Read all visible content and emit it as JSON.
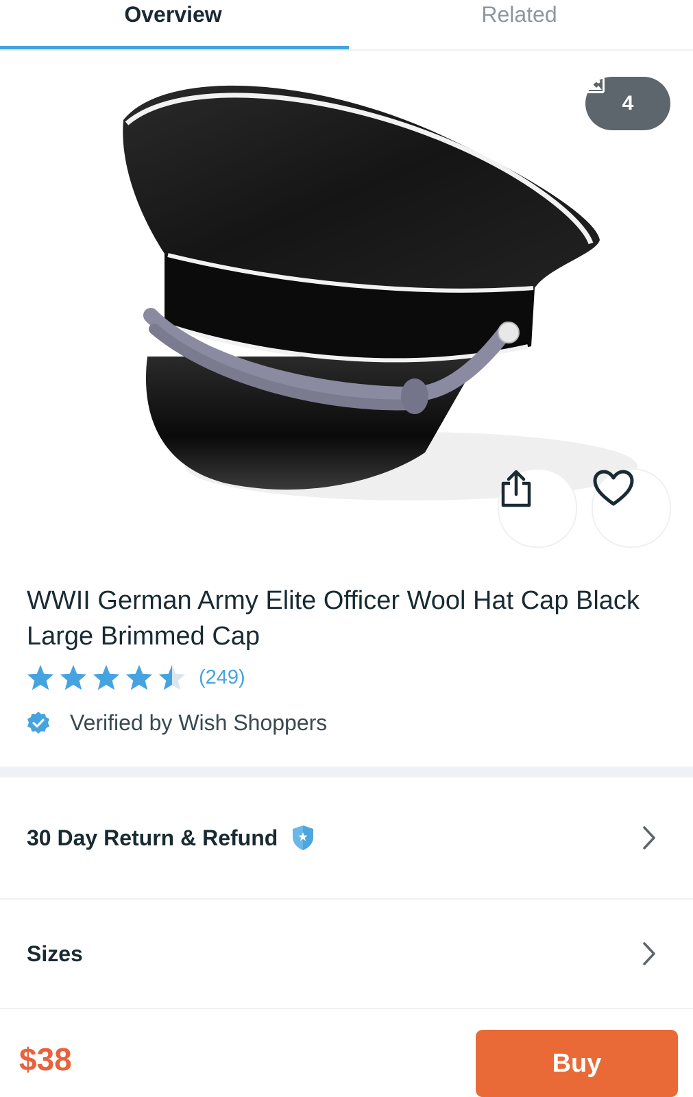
{
  "tabs": [
    {
      "label": "Overview",
      "active": true
    },
    {
      "label": "Related",
      "active": false
    }
  ],
  "gallery": {
    "photo_count": "4",
    "photo_icon": "image-icon",
    "share_icon": "share-icon",
    "wishlist_icon": "heart-icon"
  },
  "product": {
    "title": "WWII German Army Elite Officer Wool Hat Cap Black Large Brimmed Cap",
    "rating_stars": 4.5,
    "rating_count": "(249)",
    "verified_text": "Verified by Wish Shoppers"
  },
  "rows": {
    "return_label": "30 Day Return & Refund",
    "sizes_label": "Sizes"
  },
  "footer": {
    "price": "$38",
    "buy_label": "Buy"
  },
  "colors": {
    "accent_blue": "#45a3df",
    "price_orange": "#e8623c",
    "buy_button": "#e96a36",
    "text_dark": "#192a32"
  }
}
